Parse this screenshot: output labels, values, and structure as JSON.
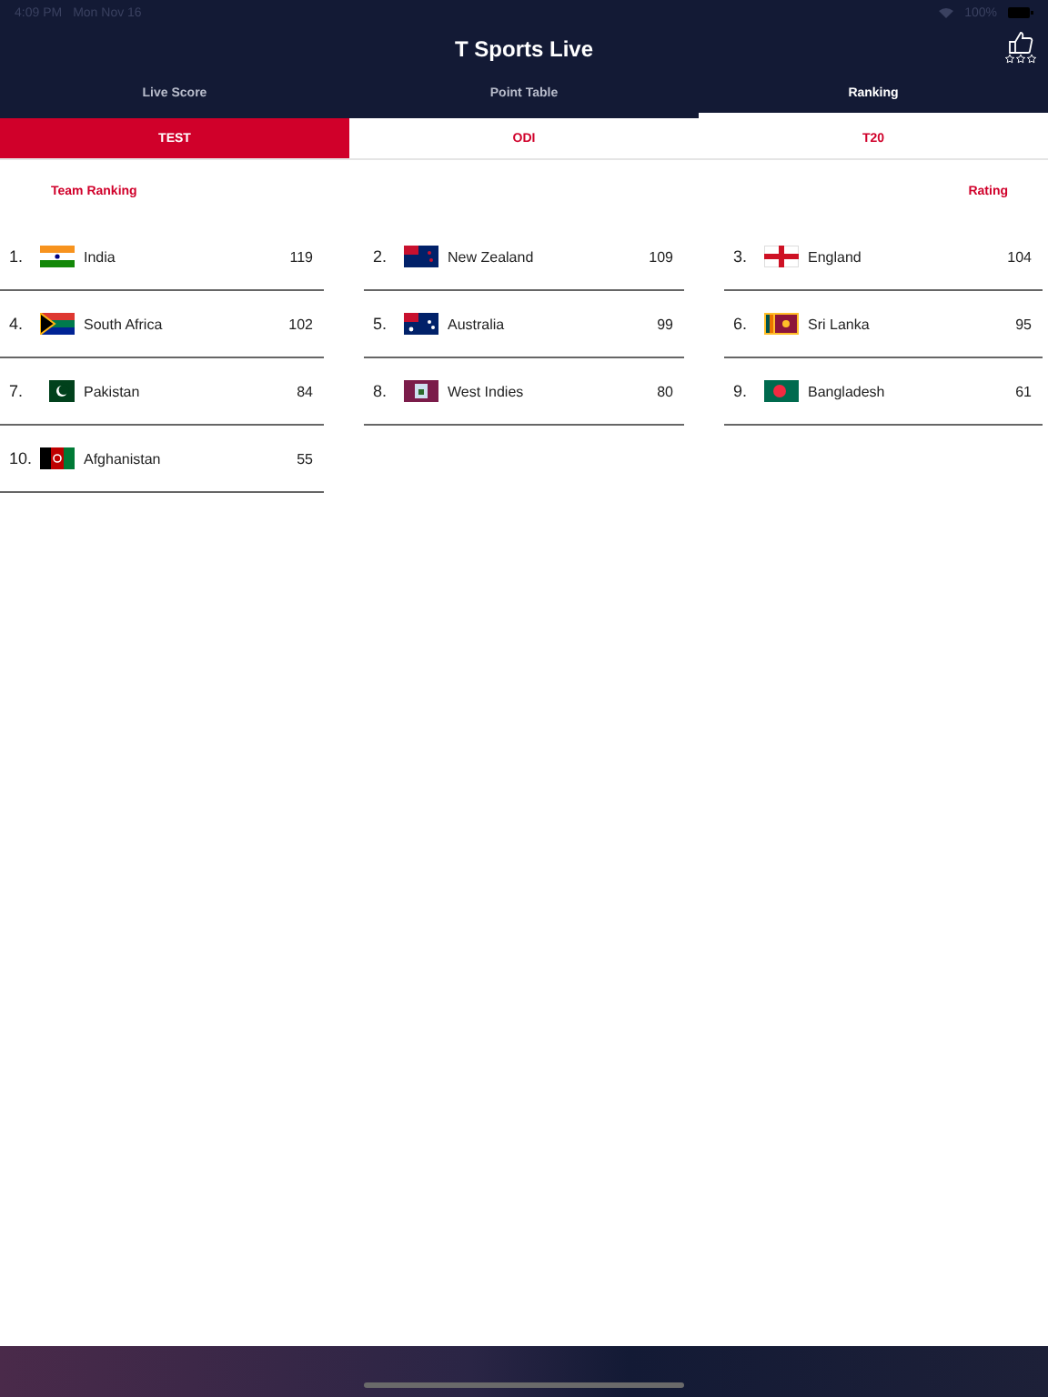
{
  "status_bar": {
    "time": "4:09 PM",
    "date": "Mon Nov 16",
    "battery": "100%"
  },
  "header": {
    "title": "T Sports Live"
  },
  "tabs": [
    {
      "label": "Live Score",
      "selected": false
    },
    {
      "label": "Point Table",
      "selected": false
    },
    {
      "label": "Ranking",
      "selected": true
    }
  ],
  "format_tabs": [
    {
      "label": "TEST",
      "selected": true
    },
    {
      "label": "ODI",
      "selected": false
    },
    {
      "label": "T20",
      "selected": false
    }
  ],
  "ranking": {
    "heading": "Team Ranking",
    "rating_heading": "Rating",
    "teams": [
      {
        "rank": "1.",
        "name": "India",
        "rating": "119"
      },
      {
        "rank": "2.",
        "name": "New Zealand",
        "rating": "109"
      },
      {
        "rank": "3.",
        "name": "England",
        "rating": "104"
      },
      {
        "rank": "4.",
        "name": "South Africa",
        "rating": "102"
      },
      {
        "rank": "5.",
        "name": "Australia",
        "rating": "99"
      },
      {
        "rank": "6.",
        "name": "Sri Lanka",
        "rating": "95"
      },
      {
        "rank": "7.",
        "name": "Pakistan",
        "rating": "84"
      },
      {
        "rank": "8.",
        "name": "West Indies",
        "rating": "80"
      },
      {
        "rank": "9.",
        "name": "Bangladesh",
        "rating": "61"
      },
      {
        "rank": "10.",
        "name": "Afghanistan",
        "rating": "55"
      }
    ]
  }
}
